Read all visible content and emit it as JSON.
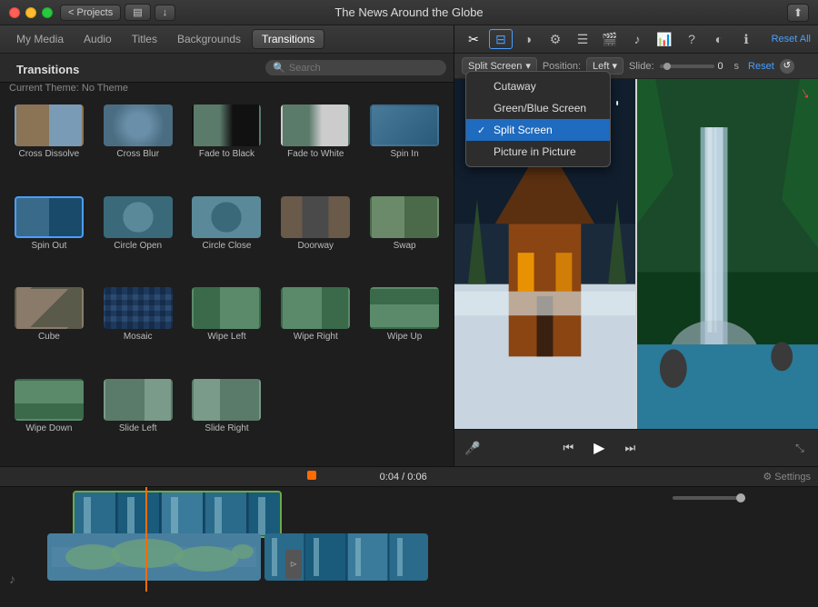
{
  "titlebar": {
    "title": "The News Around the Globe",
    "projects_btn": "< Projects",
    "share_icon": "⬆"
  },
  "media_nav": {
    "tabs": [
      "My Media",
      "Audio",
      "Titles",
      "Backgrounds",
      "Transitions"
    ]
  },
  "search": {
    "placeholder": "Search"
  },
  "left_panel": {
    "section_label": "Transitions",
    "theme_label": "Current Theme: No Theme"
  },
  "transitions": [
    {
      "id": "cross-dissolve",
      "label": "Cross Dissolve",
      "css_class": "t-cross-dissolve"
    },
    {
      "id": "cross-blur",
      "label": "Cross Blur",
      "css_class": "t-cross-blur"
    },
    {
      "id": "fade-black",
      "label": "Fade to Black",
      "css_class": "t-fade-black"
    },
    {
      "id": "fade-white",
      "label": "Fade to White",
      "css_class": "t-fade-white"
    },
    {
      "id": "spin-in",
      "label": "Spin In",
      "css_class": "t-spin-in"
    },
    {
      "id": "spin-out",
      "label": "Spin Out",
      "css_class": "t-spin-out",
      "selected": true
    },
    {
      "id": "circle-open",
      "label": "Circle Open",
      "css_class": "t-circle-open"
    },
    {
      "id": "circle-close",
      "label": "Circle Close",
      "css_class": "t-circle-close"
    },
    {
      "id": "doorway",
      "label": "Doorway",
      "css_class": "t-doorway"
    },
    {
      "id": "swap",
      "label": "Swap",
      "css_class": "t-swap"
    },
    {
      "id": "cube",
      "label": "Cube",
      "css_class": "t-cube"
    },
    {
      "id": "mosaic",
      "label": "Mosaic",
      "css_class": "t-mosaic"
    },
    {
      "id": "wipe-left",
      "label": "Wipe Left",
      "css_class": "t-wipe-left"
    },
    {
      "id": "wipe-right",
      "label": "Wipe Right",
      "css_class": "t-wipe-right"
    },
    {
      "id": "wipe-up",
      "label": "Wipe Up",
      "css_class": "t-wipe-up"
    },
    {
      "id": "wipe-down",
      "label": "Wipe Down",
      "css_class": "t-wipe-down"
    },
    {
      "id": "slide-left",
      "label": "Slide Left",
      "css_class": "t-slide-left"
    },
    {
      "id": "slide-right",
      "label": "Slide Right",
      "css_class": "t-slide-right"
    }
  ],
  "inspector": {
    "split_screen_label": "Split Screen",
    "position_label": "Position:",
    "position_value": "Left",
    "slide_label": "Slide:",
    "slide_value": "0",
    "slide_unit": "s",
    "reset_label": "Reset",
    "reset_all_label": "Reset All"
  },
  "dropdown": {
    "items": [
      {
        "label": "Cutaway",
        "selected": false
      },
      {
        "label": "Green/Blue Screen",
        "selected": false
      },
      {
        "label": "Split Screen",
        "selected": true
      },
      {
        "label": "Picture in Picture",
        "selected": false
      }
    ]
  },
  "toolbar": {
    "icons": [
      "✂",
      "⊞",
      "◑",
      "⚙",
      "☰",
      "🎬",
      "♪",
      "📊",
      "?",
      "◐",
      "ℹ"
    ],
    "icon_names": [
      "trim-icon",
      "video-overlay-icon",
      "color-icon",
      "stabilize-icon",
      "speed-icon",
      "camera-icon",
      "audio-icon",
      "chart-icon",
      "help-icon",
      "split-screen-icon",
      "info-icon"
    ]
  },
  "playback": {
    "skip_back": "⏮",
    "play": "▶",
    "skip_forward": "⏭"
  },
  "timeline": {
    "time_current": "0:04",
    "time_total": "0:06",
    "settings_label": "Settings"
  }
}
